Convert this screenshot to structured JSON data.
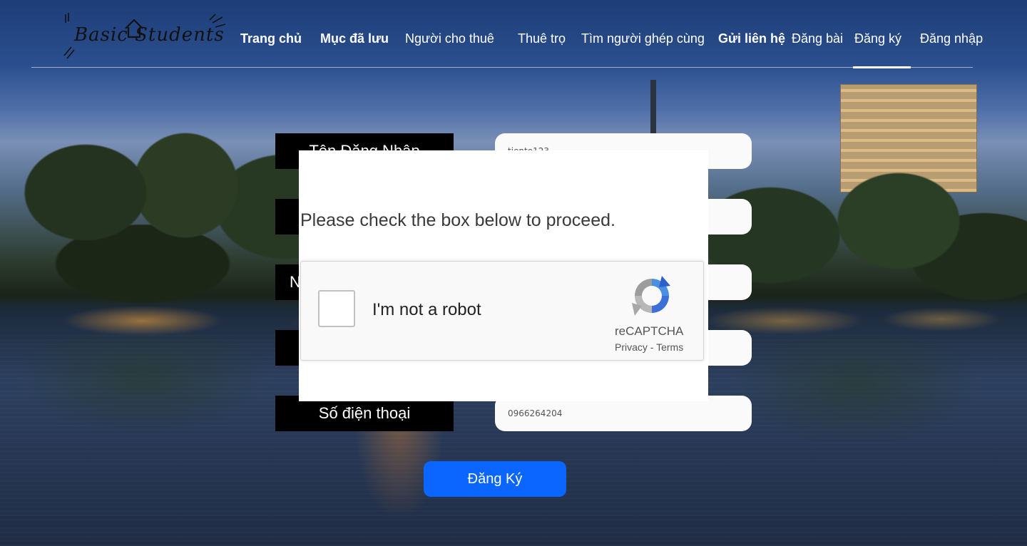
{
  "logo": {
    "text": "Basic Students"
  },
  "nav": {
    "items": [
      {
        "label": "Trang chủ",
        "bold": true
      },
      {
        "label": "Mục đã lưu",
        "bold": true
      },
      {
        "label": "Người cho thuê",
        "bold": false
      },
      {
        "label": "Thuê trọ",
        "bold": false
      },
      {
        "label": "Tìm người ghép cùng",
        "bold": false
      },
      {
        "label": "Gửi liên hệ",
        "bold": true
      },
      {
        "label": "Đăng bài",
        "bold": false
      },
      {
        "label": "Đăng ký",
        "bold": false,
        "active": true
      },
      {
        "label": "Đăng nhập",
        "bold": false
      }
    ]
  },
  "form": {
    "fields": [
      {
        "label": "Tên Đăng Nhập",
        "value": "tiento123"
      },
      {
        "label": "",
        "value": ""
      },
      {
        "label": "N",
        "value": ""
      },
      {
        "label": "",
        "value": ""
      },
      {
        "label": "Số điện thoại",
        "value": "0966264204"
      }
    ],
    "submit_label": "Đăng Ký"
  },
  "captcha": {
    "prompt": "Please check the box below to proceed.",
    "checkbox_label": "I'm not a robot",
    "checked": false,
    "brand": "reCAPTCHA",
    "privacy_label": "Privacy",
    "separator": " - ",
    "terms_label": "Terms"
  },
  "colors": {
    "submit_button": "#0a66ff",
    "label_background": "#000000",
    "input_background": "#fafafa",
    "active_underline": "#ffffff"
  }
}
